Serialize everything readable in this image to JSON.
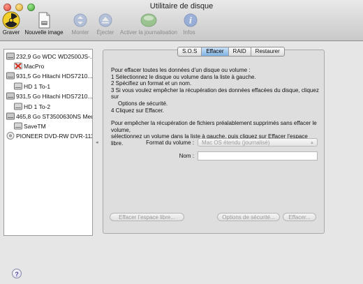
{
  "window": {
    "title": "Utilitaire de disque"
  },
  "toolbar": {
    "burn": "Graver",
    "new_image": "Nouvelle image",
    "mount": "Monter",
    "eject": "Éjecter",
    "enable_journaling": "Activer la journalisation",
    "info": "Infos"
  },
  "sidebar": {
    "items": [
      {
        "label": "232,9 Go WDC WD2500JS-...",
        "icon": "hard-disk-icon"
      },
      {
        "label": "MacPro",
        "icon": "volume-error-icon"
      },
      {
        "label": "931,5 Go Hitachi HDS7210...",
        "icon": "hard-disk-icon"
      },
      {
        "label": "HD 1 To-1",
        "icon": "volume-icon"
      },
      {
        "label": "931,5 Go Hitachi HDS7210...",
        "icon": "hard-disk-icon"
      },
      {
        "label": "HD 1 To-2",
        "icon": "volume-icon"
      },
      {
        "label": "465,8 Go ST3500630NS Med",
        "icon": "hard-disk-icon"
      },
      {
        "label": "SaveTM",
        "icon": "volume-icon"
      },
      {
        "label": "PIONEER DVD-RW DVR-111",
        "icon": "optical-drive-icon"
      }
    ]
  },
  "tabs": {
    "sos": "S.O.S",
    "erase": "Effacer",
    "raid": "RAID",
    "restore": "Restaurer",
    "active": "Effacer"
  },
  "instructions": {
    "intro": "Pour effacer toutes les données d’un disque ou volume :",
    "step1": "1  Sélectionnez le disque ou volume dans la liste à gauche.",
    "step2": "2  Spécifiez un format et un nom.",
    "step3": "3  Si vous voulez empêcher la récupération des données effacées du disque, cliquez sur",
    "step3b": "Options de sécurité.",
    "step4": "4  Cliquez sur Effacer.",
    "note1": "Pour empêcher la récupération de fichiers préalablement supprimés sans effacer le volume,",
    "note2": "sélectionnez un volume dans la liste à gauche, puis cliquez sur Effacer l’espace libre."
  },
  "form": {
    "format_label": "Format du volume :",
    "format_value": "Mac OS étendu (journalisé)",
    "name_label": "Nom :",
    "name_value": ""
  },
  "buttons": {
    "erase_free_space": "Effacer l’espace libre...",
    "security_options": "Options de sécurité...",
    "erase": "Effacer..."
  },
  "help": {
    "label": "?"
  }
}
